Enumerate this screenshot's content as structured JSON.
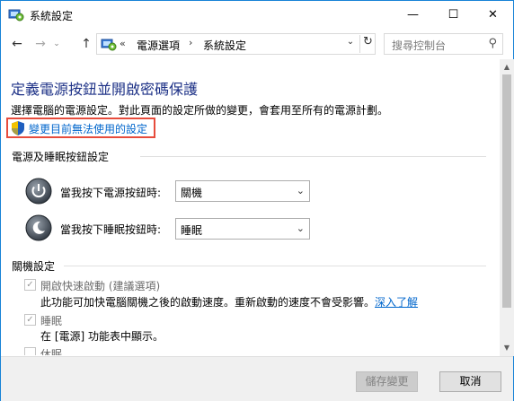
{
  "window": {
    "title": "系統設定",
    "minimize_glyph": "—",
    "maximize_glyph": "☐",
    "close_glyph": "✕"
  },
  "nav": {
    "back_glyph": "←",
    "forward_glyph": "→",
    "recent_glyph": "⌄",
    "up_glyph": "↑",
    "breadcrumb_prefix": "«",
    "breadcrumb": [
      "電源選項",
      "系統設定"
    ],
    "breadcrumb_separator": "›",
    "dropdown_glyph": "⌄",
    "refresh_glyph": "↻",
    "search_placeholder": "搜尋控制台",
    "search_glyph": "⚲"
  },
  "page": {
    "title": "定義電源按鈕並開啟密碼保護",
    "description": "選擇電腦的電源設定。對此頁面的設定所做的變更，會套用至所有的電源計劃。",
    "change_link": "變更目前無法使用的設定"
  },
  "power_section": {
    "title": "電源及睡眠按鈕設定",
    "rows": [
      {
        "label": "當我按下電源按鈕時:",
        "value": "關機"
      },
      {
        "label": "當我按下睡眠按鈕時:",
        "value": "睡眠"
      }
    ],
    "select_arrow": "⌄"
  },
  "shutdown_section": {
    "title": "關機設定",
    "items": [
      {
        "label": "開啟快速啟動 (建議選項)",
        "checked": true,
        "check_glyph": "✓",
        "description": "此功能可加快電腦關機之後的啟動速度。重新啟動的速度不會受影響。",
        "link": "深入了解"
      },
      {
        "label": "睡眠",
        "checked": true,
        "check_glyph": "✓",
        "description": "在 [電源] 功能表中顯示。"
      },
      {
        "label": "休眠",
        "checked": false,
        "check_glyph": ""
      }
    ]
  },
  "scrollbar": {
    "up_glyph": "▲",
    "down_glyph": "▼"
  },
  "footer": {
    "save_label": "儲存變更",
    "cancel_label": "取消"
  },
  "colors": {
    "title_blue": "#1e3287",
    "link_blue": "#0066cc",
    "highlight_red": "#e74c3c",
    "window_border": "#1883d7"
  }
}
